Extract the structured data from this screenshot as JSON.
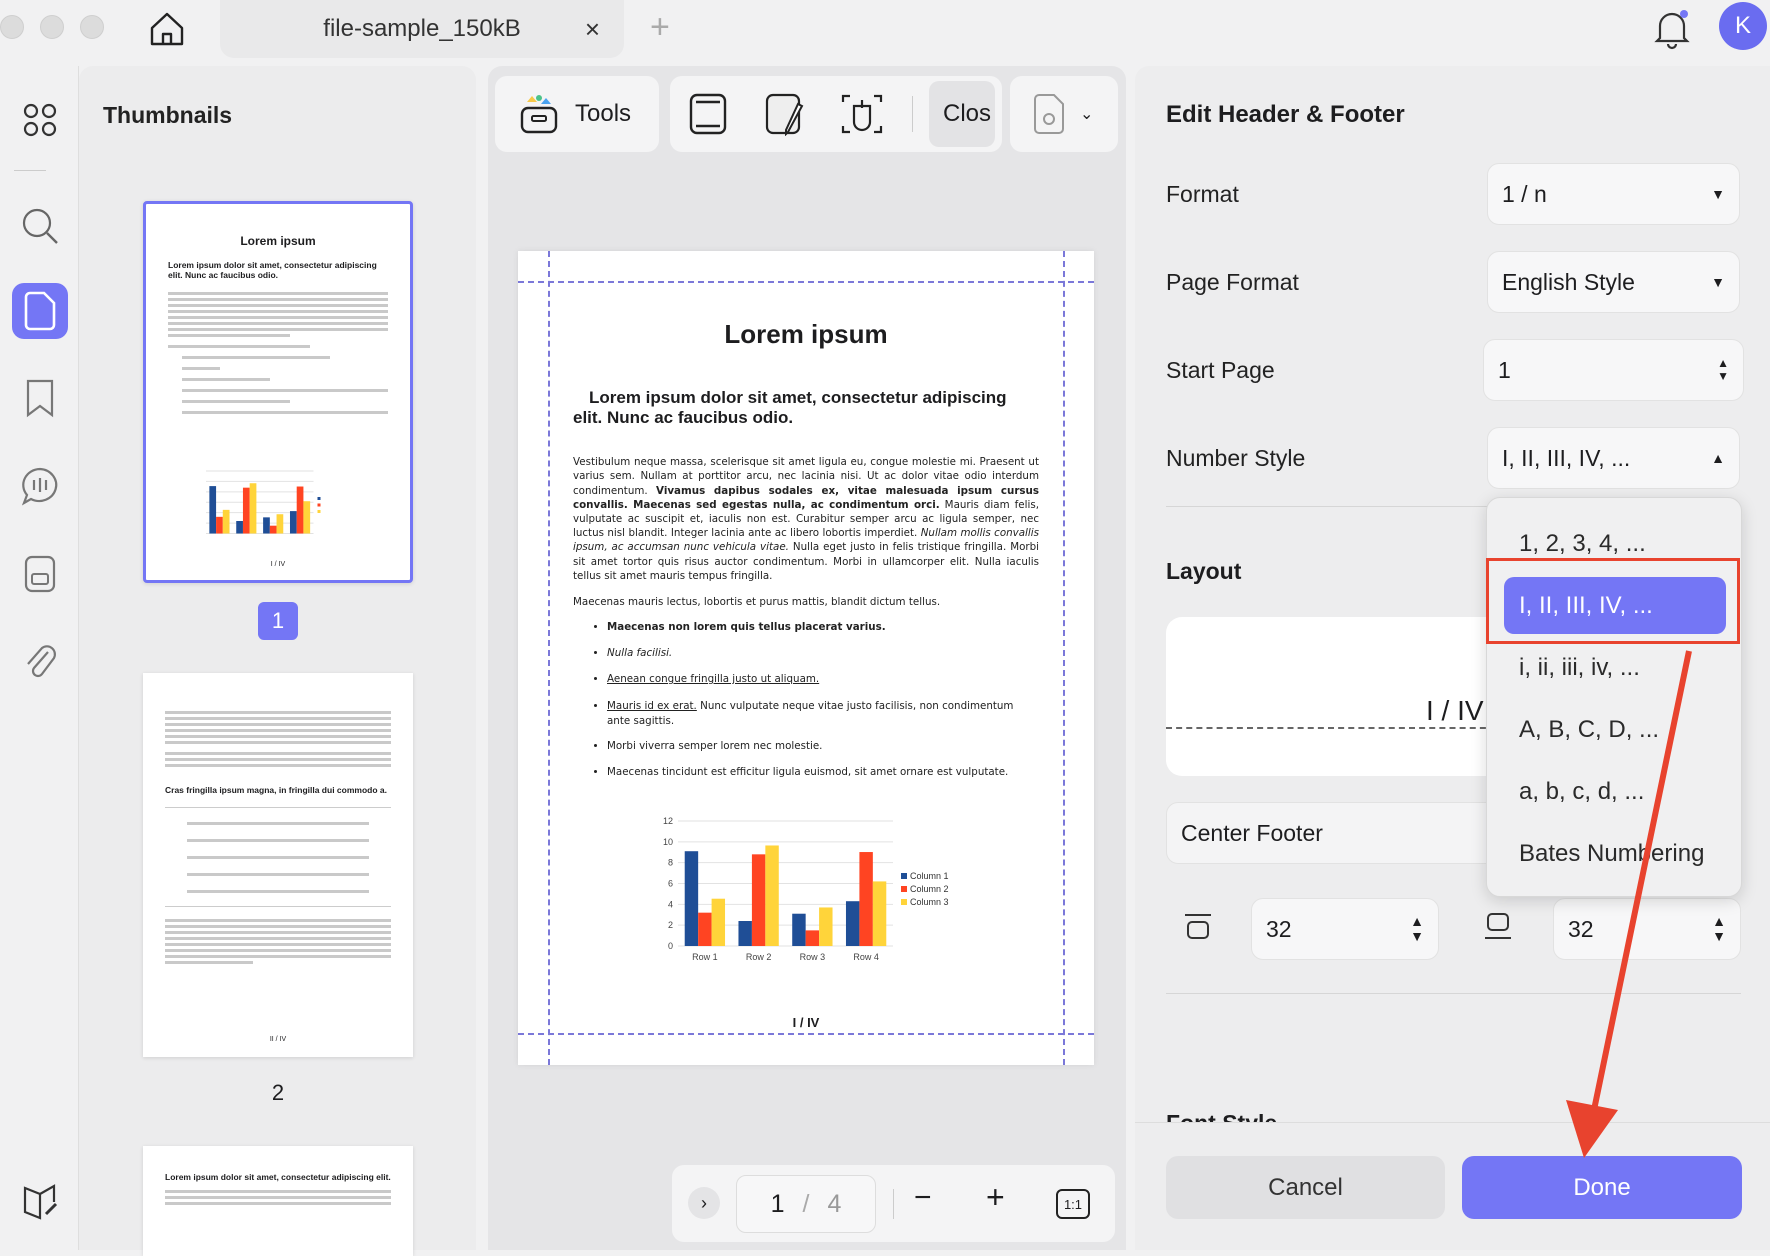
{
  "window": {
    "tab_title": "file-sample_150kB",
    "close_tab": "×",
    "new_tab": "+",
    "avatar_initial": "K"
  },
  "sidebar": {
    "title": "Thumbnails",
    "pages": [
      {
        "label": "1",
        "title": "Lorem ipsum",
        "heading": "Lorem ipsum dolor sit amet, consectetur adipiscing elit. Nunc ac faucibus odio.",
        "footer": "I / IV"
      },
      {
        "label": "2",
        "heading": "Cras fringilla ipsum magna, in fringilla dui commodo a.",
        "footer": "II / IV"
      },
      {
        "heading": "Lorem ipsum dolor sit amet, consectetur adipiscing elit."
      }
    ]
  },
  "toolbar": {
    "tools_label": "Tools",
    "close_label": "Clos"
  },
  "document": {
    "title": "Lorem ipsum",
    "heading": "Lorem ipsum dolor sit amet, consectetur adipiscing elit. Nunc ac faucibus odio.",
    "p1a": "Vestibulum neque massa, scelerisque sit amet ligula eu, congue molestie mi. Praesent ut varius sem. Nullam at porttitor arcu, nec lacinia nisi. Ut ac dolor vitae odio interdum condimentum. ",
    "p1b": "Vivamus dapibus sodales ex, vitae malesuada ipsum cursus convallis. Maecenas sed egestas nulla, ac condimentum orci.",
    "p1c": " Mauris diam felis, vulputate ac suscipit et, iaculis non est. Curabitur semper arcu ac ligula semper, nec luctus nisl blandit. Integer lacinia ante ac libero lobortis imperdiet. ",
    "p1d": "Nullam mollis convallis ipsum, ac accumsan nunc vehicula vitae.",
    "p1e": " Nulla eget justo in felis tristique fringilla. Morbi sit amet tortor quis risus auctor condimentum. Morbi in ullamcorper elit. Nulla iaculis tellus sit amet mauris tempus fringilla.",
    "p2": "Maecenas mauris lectus, lobortis et purus mattis, blandit dictum tellus.",
    "b1": "Maecenas non lorem quis tellus placerat varius.",
    "b2": "Nulla facilisi.",
    "b3": "Aenean congue fringilla justo ut aliquam.",
    "b4a": "Mauris id ex erat.",
    "b4b": " Nunc vulputate neque vitae justo facilisis, non condimentum ante sagittis.",
    "b5": "Morbi viverra semper lorem nec molestie.",
    "b6": "Maecenas tincidunt est efficitur ligula euismod, sit amet ornare est vulputate.",
    "footer": "I / IV"
  },
  "chart_data": {
    "type": "bar",
    "categories": [
      "Row 1",
      "Row 2",
      "Row 3",
      "Row 4"
    ],
    "series": [
      {
        "name": "Column 1",
        "color": "#1f4e96",
        "values": [
          9.1,
          2.4,
          3.1,
          4.3
        ]
      },
      {
        "name": "Column 2",
        "color": "#ff4422",
        "values": [
          3.2,
          8.8,
          1.5,
          9.02
        ]
      },
      {
        "name": "Column 3",
        "color": "#ffd43a",
        "values": [
          4.54,
          9.65,
          3.7,
          6.2
        ]
      }
    ],
    "ylim": [
      0,
      12
    ],
    "yticks": [
      "0",
      "2",
      "4",
      "6",
      "8",
      "10",
      "12"
    ],
    "legend": "right",
    "grid": true,
    "title": "",
    "xlabel": "",
    "ylabel": ""
  },
  "pager": {
    "current": "1",
    "sep": "/",
    "total": "4",
    "fit": "1:1"
  },
  "panel": {
    "title": "Edit Header & Footer",
    "format_label": "Format",
    "format_value": "1 / n",
    "page_format_label": "Page Format",
    "page_format_value": "English Style",
    "start_page_label": "Start Page",
    "start_page_value": "1",
    "number_style_label": "Number Style",
    "number_style_value": "I, II, III, IV, ...",
    "layout_label": "Layout",
    "preview_text": "I / IV",
    "position_value": "Center Footer",
    "top_margin": "32",
    "bottom_margin": "32",
    "font_style_label": "Font Style",
    "cancel": "Cancel",
    "done": "Done",
    "accent": "#7476f5"
  },
  "dropdown": {
    "options": [
      "1, 2, 3, 4, ...",
      "I, II, III, IV, ...",
      "i, ii, iii, iv, ...",
      "A, B, C, D, ...",
      "a, b, c, d, ...",
      "Bates Numbering"
    ],
    "selected_index": 1
  }
}
